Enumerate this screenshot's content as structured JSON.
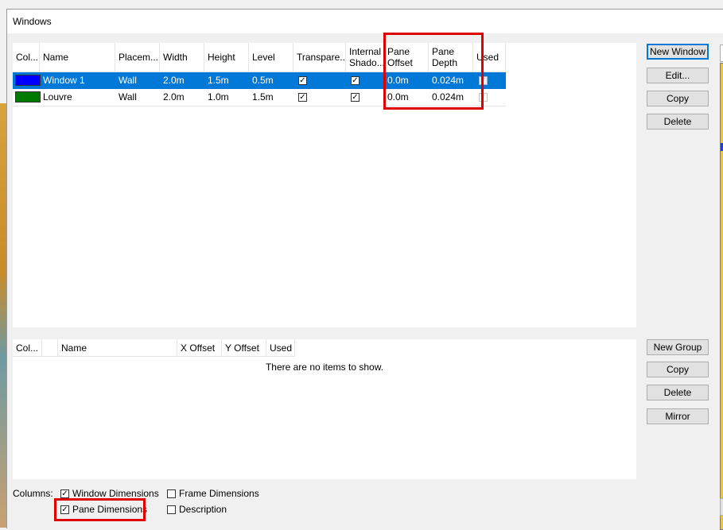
{
  "window_title": "Windows",
  "windows_table": {
    "columns": [
      "Col...",
      "Name",
      "Placem...",
      "Width",
      "Height",
      "Level",
      "Transpare...",
      "Internal Shado...",
      "Pane Offset",
      "Pane Depth",
      "Used"
    ],
    "rows": [
      {
        "color": "#0000ff",
        "name": "Window 1",
        "placement": "Wall",
        "width": "2.0m",
        "height": "1.5m",
        "level": "0.5m",
        "transparent": true,
        "internal_shadow": true,
        "pane_offset": "0.0m",
        "pane_depth": "0.024m",
        "used": true,
        "selected": true
      },
      {
        "color": "#007a00",
        "name": "Louvre",
        "placement": "Wall",
        "width": "2.0m",
        "height": "1.0m",
        "level": "1.5m",
        "transparent": true,
        "internal_shadow": true,
        "pane_offset": "0.0m",
        "pane_depth": "0.024m",
        "used": true,
        "selected": false
      }
    ]
  },
  "groups_table": {
    "columns": [
      "Col...",
      "",
      "Name",
      "X Offset",
      "Y Offset",
      "Used"
    ],
    "empty_text": "There are no items to show."
  },
  "buttons": {
    "new_window": "New Window",
    "edit": "Edit...",
    "copy": "Copy",
    "delete": "Delete",
    "new_group": "New Group",
    "copy_group": "Copy",
    "delete_group": "Delete",
    "mirror": "Mirror"
  },
  "columns_options": {
    "label": "Columns:",
    "window_dimensions": {
      "label": "Window Dimensions",
      "checked": true
    },
    "frame_dimensions": {
      "label": "Frame Dimensions",
      "checked": false
    },
    "pane_dimensions": {
      "label": "Pane Dimensions",
      "checked": true
    },
    "description": {
      "label": "Description",
      "checked": false
    }
  },
  "highlight_color": "#e00000",
  "selection_color": "#0078d7"
}
